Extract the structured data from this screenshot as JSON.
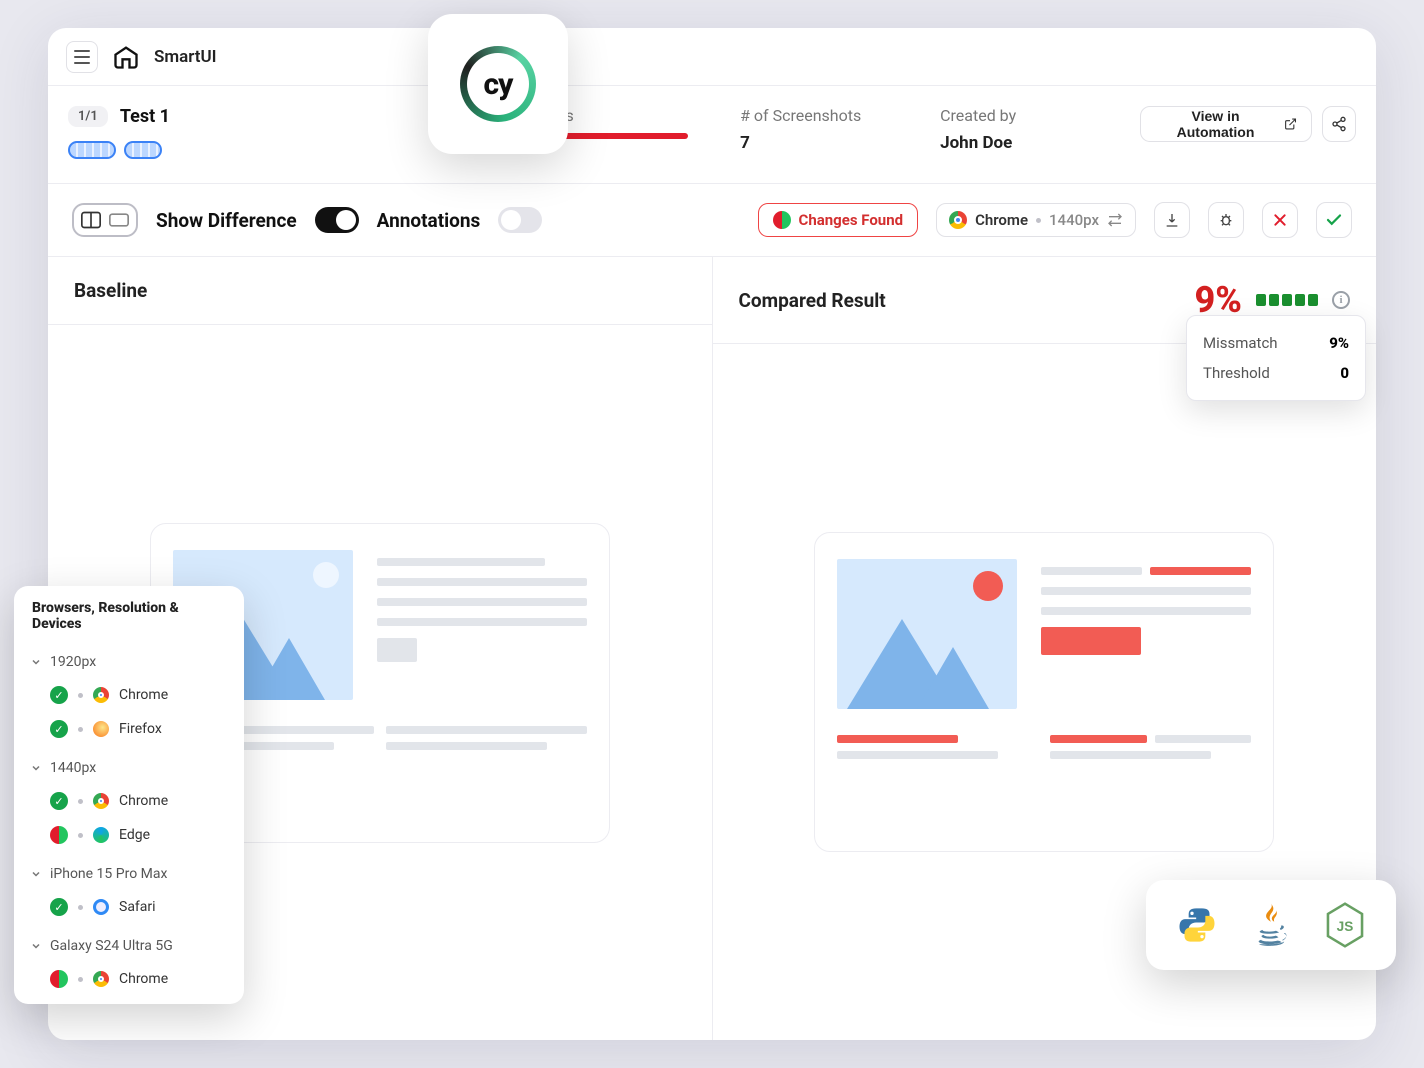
{
  "header": {
    "appName": "SmartUI"
  },
  "test": {
    "countBadge": "1/1",
    "name": "Test 1",
    "status": {
      "label": "Status"
    },
    "screenshots": {
      "label": "# of Screenshots",
      "value": "7"
    },
    "createdBy": {
      "label": "Created by",
      "value": "John Doe"
    },
    "actions": {
      "viewInAutomation": "View in Automation"
    }
  },
  "toolbar": {
    "showDiff": {
      "label": "Show Difference",
      "on": true
    },
    "annotations": {
      "label": "Annotations",
      "on": false
    },
    "changesBadge": "Changes Found",
    "browser": "Chrome",
    "resolution": "1440px"
  },
  "compare": {
    "left": {
      "title": "Baseline"
    },
    "right": {
      "title": "Compared Result",
      "mismatchPercent": "9%",
      "popover": {
        "rows": [
          {
            "k": "Missmatch",
            "v": "9%"
          },
          {
            "k": "Threshold",
            "v": "0"
          }
        ]
      }
    }
  },
  "browsersPanel": {
    "title": "Browsers, Resolution & Devices",
    "groups": [
      {
        "name": "1920px",
        "items": [
          {
            "status": "pass",
            "browser": "Chrome",
            "browserIcon": "chrome"
          },
          {
            "status": "pass",
            "browser": "Firefox",
            "browserIcon": "firefox"
          }
        ]
      },
      {
        "name": "1440px",
        "items": [
          {
            "status": "pass",
            "browser": "Chrome",
            "browserIcon": "chrome"
          },
          {
            "status": "diff",
            "browser": "Edge",
            "browserIcon": "edge"
          }
        ]
      },
      {
        "name": "iPhone 15 Pro Max",
        "items": [
          {
            "status": "pass",
            "browser": "Safari",
            "browserIcon": "safari"
          }
        ]
      },
      {
        "name": "Galaxy S24 Ultra 5G",
        "items": [
          {
            "status": "diff",
            "browser": "Chrome",
            "browserIcon": "chrome"
          }
        ]
      }
    ]
  },
  "langs": [
    "python",
    "java",
    "nodejs"
  ],
  "floatingLogo": "cypress"
}
